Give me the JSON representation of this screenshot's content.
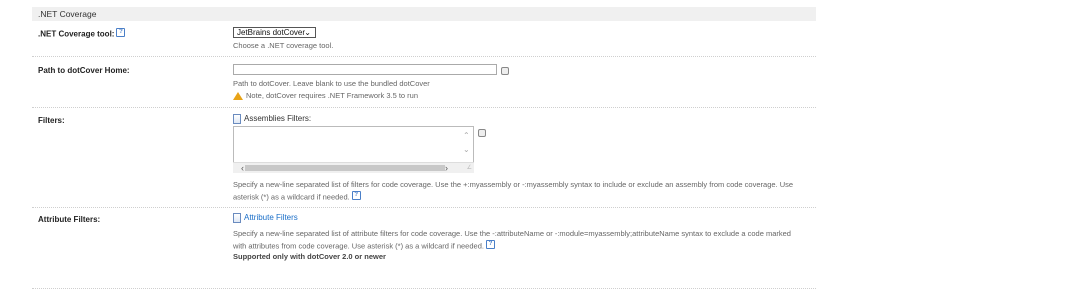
{
  "section": {
    "title": ".NET Coverage"
  },
  "coverage_tool": {
    "label": ".NET Coverage tool:",
    "selected": "JetBrains dotCover",
    "note": "Choose a .NET coverage tool."
  },
  "dotcover_home": {
    "label": "Path to dotCover Home:",
    "value": "",
    "note": "Path to dotCover. Leave blank to use the bundled dotCover",
    "warning": "Note, dotCover requires .NET Framework 3.5 to run"
  },
  "filters": {
    "label": "Filters:",
    "sub_label": "Assemblies Filters:",
    "value": "",
    "note_line1": "Specify a new-line separated list of filters for code coverage. Use the +:myassembly or -:myassembly syntax to include or exclude an assembly from code coverage. Use",
    "note_line2": "asterisk (*) as a wildcard if needed."
  },
  "attribute_filters": {
    "label": "Attribute Filters:",
    "link": "Attribute Filters",
    "note_line1": "Specify a new-line separated list of attribute filters for code coverage. Use the -:attributeName or -:module=myassembly;attributeName syntax to exclude a code marked",
    "note_line2": "with attributes from code coverage. Use asterisk (*) as a wildcard if needed.",
    "supported": "Supported only with dotCover 2.0 or newer"
  },
  "icons": {
    "help": "?"
  }
}
